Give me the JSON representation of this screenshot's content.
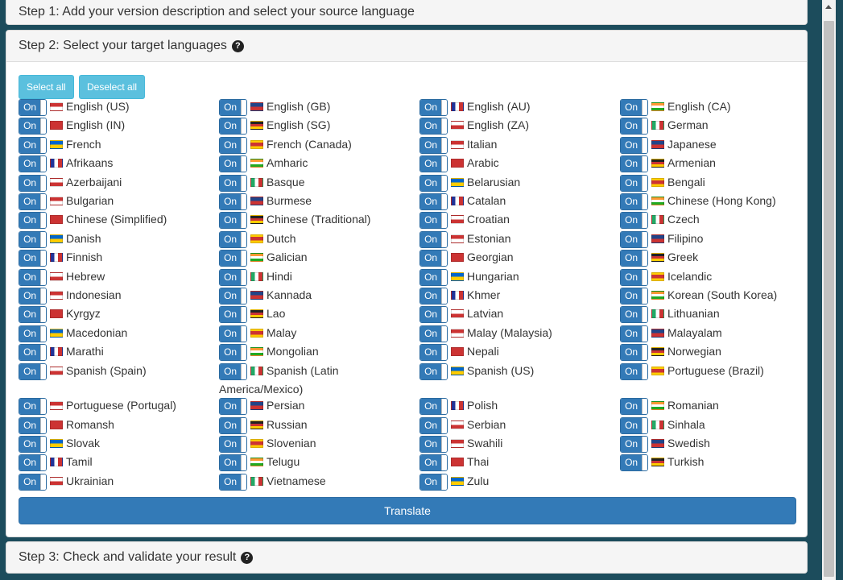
{
  "step1": {
    "title": "Step 1: Add your version description and select your source language"
  },
  "step2": {
    "title": "Step 2: Select your target languages",
    "select_all": "Select all",
    "deselect_all": "Deselect all",
    "toggle_label": "On",
    "translate": "Translate",
    "languages": [
      [
        "English (US)",
        "English (GB)",
        "English (AU)",
        "English (CA)"
      ],
      [
        "English (IN)",
        "English (SG)",
        "English (ZA)",
        "German"
      ],
      [
        "French",
        "French (Canada)",
        "Italian",
        "Japanese"
      ],
      [
        "Afrikaans",
        "Amharic",
        "Arabic",
        "Armenian"
      ],
      [
        "Azerbaijani",
        "Basque",
        "Belarusian",
        "Bengali"
      ],
      [
        "Bulgarian",
        "Burmese",
        "Catalan",
        "Chinese (Hong Kong)"
      ],
      [
        "Chinese (Simplified)",
        "Chinese (Traditional)",
        "Croatian",
        "Czech"
      ],
      [
        "Danish",
        "Dutch",
        "Estonian",
        "Filipino"
      ],
      [
        "Finnish",
        "Galician",
        "Georgian",
        "Greek"
      ],
      [
        "Hebrew",
        "Hindi",
        "Hungarian",
        "Icelandic"
      ],
      [
        "Indonesian",
        "Kannada",
        "Khmer",
        "Korean (South Korea)"
      ],
      [
        "Kyrgyz",
        "Lao",
        "Latvian",
        "Lithuanian"
      ],
      [
        "Macedonian",
        "Malay",
        "Malay (Malaysia)",
        "Malayalam"
      ],
      [
        "Marathi",
        "Mongolian",
        "Nepali",
        "Norwegian"
      ],
      [
        "Spanish (Spain)",
        "Spanish (Latin America/Mexico)",
        "Spanish (US)",
        "Portuguese (Brazil)"
      ],
      [
        "Portuguese (Portugal)",
        "Persian",
        "Polish",
        "Romanian"
      ],
      [
        "Romansh",
        "Russian",
        "Serbian",
        "Sinhala"
      ],
      [
        "Slovak",
        "Slovenian",
        "Swahili",
        "Swedish"
      ],
      [
        "Tamil",
        "Telugu",
        "Thai",
        "Turkish"
      ],
      [
        "Ukrainian",
        "Vietnamese",
        "Zulu"
      ]
    ]
  },
  "step3": {
    "title": "Step 3: Check and validate your result"
  },
  "colors": {
    "accent": "#337ab7",
    "info": "#5bc0de",
    "background": "#1c4c5c"
  }
}
